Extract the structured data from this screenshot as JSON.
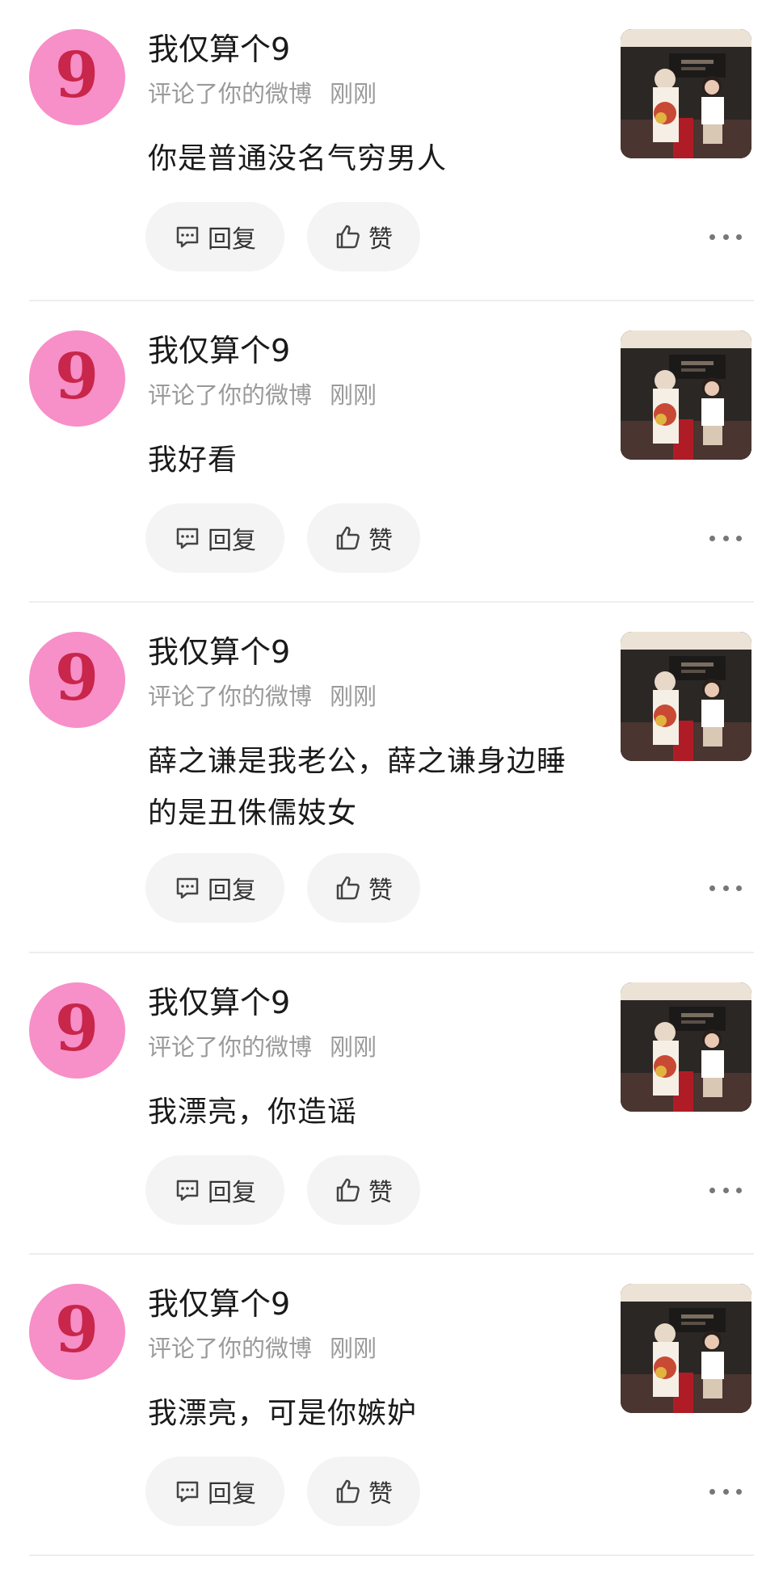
{
  "comments": [
    {
      "avatar_char": "9",
      "user_name": "我仅算个9",
      "action_text": "评论了你的微博",
      "time": "刚刚",
      "content": "你是普通没名气穷男人",
      "reply_label": "回复",
      "like_label": "赞"
    },
    {
      "avatar_char": "9",
      "user_name": "我仅算个9",
      "action_text": "评论了你的微博",
      "time": "刚刚",
      "content": "我好看",
      "reply_label": "回复",
      "like_label": "赞"
    },
    {
      "avatar_char": "9",
      "user_name": "我仅算个9",
      "action_text": "评论了你的微博",
      "time": "刚刚",
      "content": "薛之谦是我老公，薛之谦身边睡的是丑侏儒妓女",
      "reply_label": "回复",
      "like_label": "赞"
    },
    {
      "avatar_char": "9",
      "user_name": "我仅算个9",
      "action_text": "评论了你的微博",
      "time": "刚刚",
      "content": "我漂亮，你造谣",
      "reply_label": "回复",
      "like_label": "赞"
    },
    {
      "avatar_char": "9",
      "user_name": "我仅算个9",
      "action_text": "评论了你的微博",
      "time": "刚刚",
      "content": "我漂亮，可是你嫉妒",
      "reply_label": "回复",
      "like_label": "赞"
    }
  ],
  "colors": {
    "avatar_bg": "#f78fc8",
    "avatar_digit": "#c8264a",
    "meta_text": "#9a9a9a",
    "button_bg": "#f4f4f4"
  },
  "icons": {
    "reply": "comment-bubble-icon",
    "like": "thumbs-up-icon",
    "more": "ellipsis-icon"
  }
}
